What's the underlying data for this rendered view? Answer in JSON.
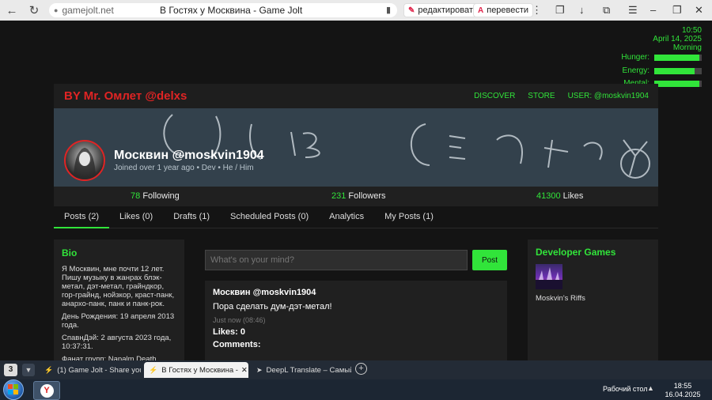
{
  "browser": {
    "domain": "gamejolt.net",
    "page_title": "В Гостях у Москвина - Game Jolt",
    "translate_edit": "редактировать",
    "translate_action": "перевести"
  },
  "hud": {
    "time": "10:50",
    "date": "April 14, 2025",
    "period": "Morning",
    "stats": [
      {
        "label": "Hunger:",
        "level": 0.95
      },
      {
        "label": "Energy:",
        "level": 0.85
      },
      {
        "label": "Mental:",
        "level": 0.95
      }
    ]
  },
  "site": {
    "brand": "BY Mr. Омлет @delxs",
    "nav": [
      "DISCOVER",
      "STORE",
      "USER: @moskvin1904"
    ],
    "banner_text": "Fucking Cemetery",
    "profile": {
      "name": "Москвин @moskvin1904",
      "meta": "Joined over 1 year ago • Dev • He / Him"
    },
    "stats": {
      "following_count": "78",
      "following_label": "Following",
      "followers_count": "231",
      "followers_label": "Followers",
      "likes_count": "41300",
      "likes_label": "Likes"
    },
    "tabs": [
      "Posts (2)",
      "Likes (0)",
      "Drafts (1)",
      "Scheduled Posts (0)",
      "Analytics",
      "My Posts (1)"
    ],
    "bio": {
      "title": "Bio",
      "paragraphs": [
        "Я Москвин, мне почти 12 лет. Пишу музыку в жанрах блэк-метал, дэт-метал, грайндкор, гор-грайнд, нойзкор, краст-панк, анархо-панк, панк и панк-рок.",
        "День Рождения: 19 апреля 2013 года.",
        "СпавнДэй: 2 августа 2023 года, 10:37:31.",
        "Фанат групп: Napalm Death,"
      ]
    },
    "composer": {
      "placeholder": "What's on your mind?",
      "button": "Post"
    },
    "post": {
      "author": "Москвин @moskvin1904",
      "text": "Пора сделать дум-дэт-метал!",
      "time": "Just now (08:46)",
      "likes": "Likes: 0",
      "comments": "Comments:"
    },
    "dev_games": {
      "title": "Developer Games",
      "game": "Moskvin's Riffs"
    }
  },
  "taskbar": {
    "tab_count": "3",
    "tabs": [
      {
        "label": "(1) Game Jolt - Share your",
        "icon": "gamejolt-icon"
      },
      {
        "label": "В Гостях у Москвина -",
        "icon": "gamejolt-icon"
      },
      {
        "label": "DeepL Translate – Самый",
        "icon": "deepl-icon"
      }
    ],
    "desktop_label": "Рабочий стол",
    "clock_time": "18:55",
    "clock_date": "16.04.2025"
  }
}
